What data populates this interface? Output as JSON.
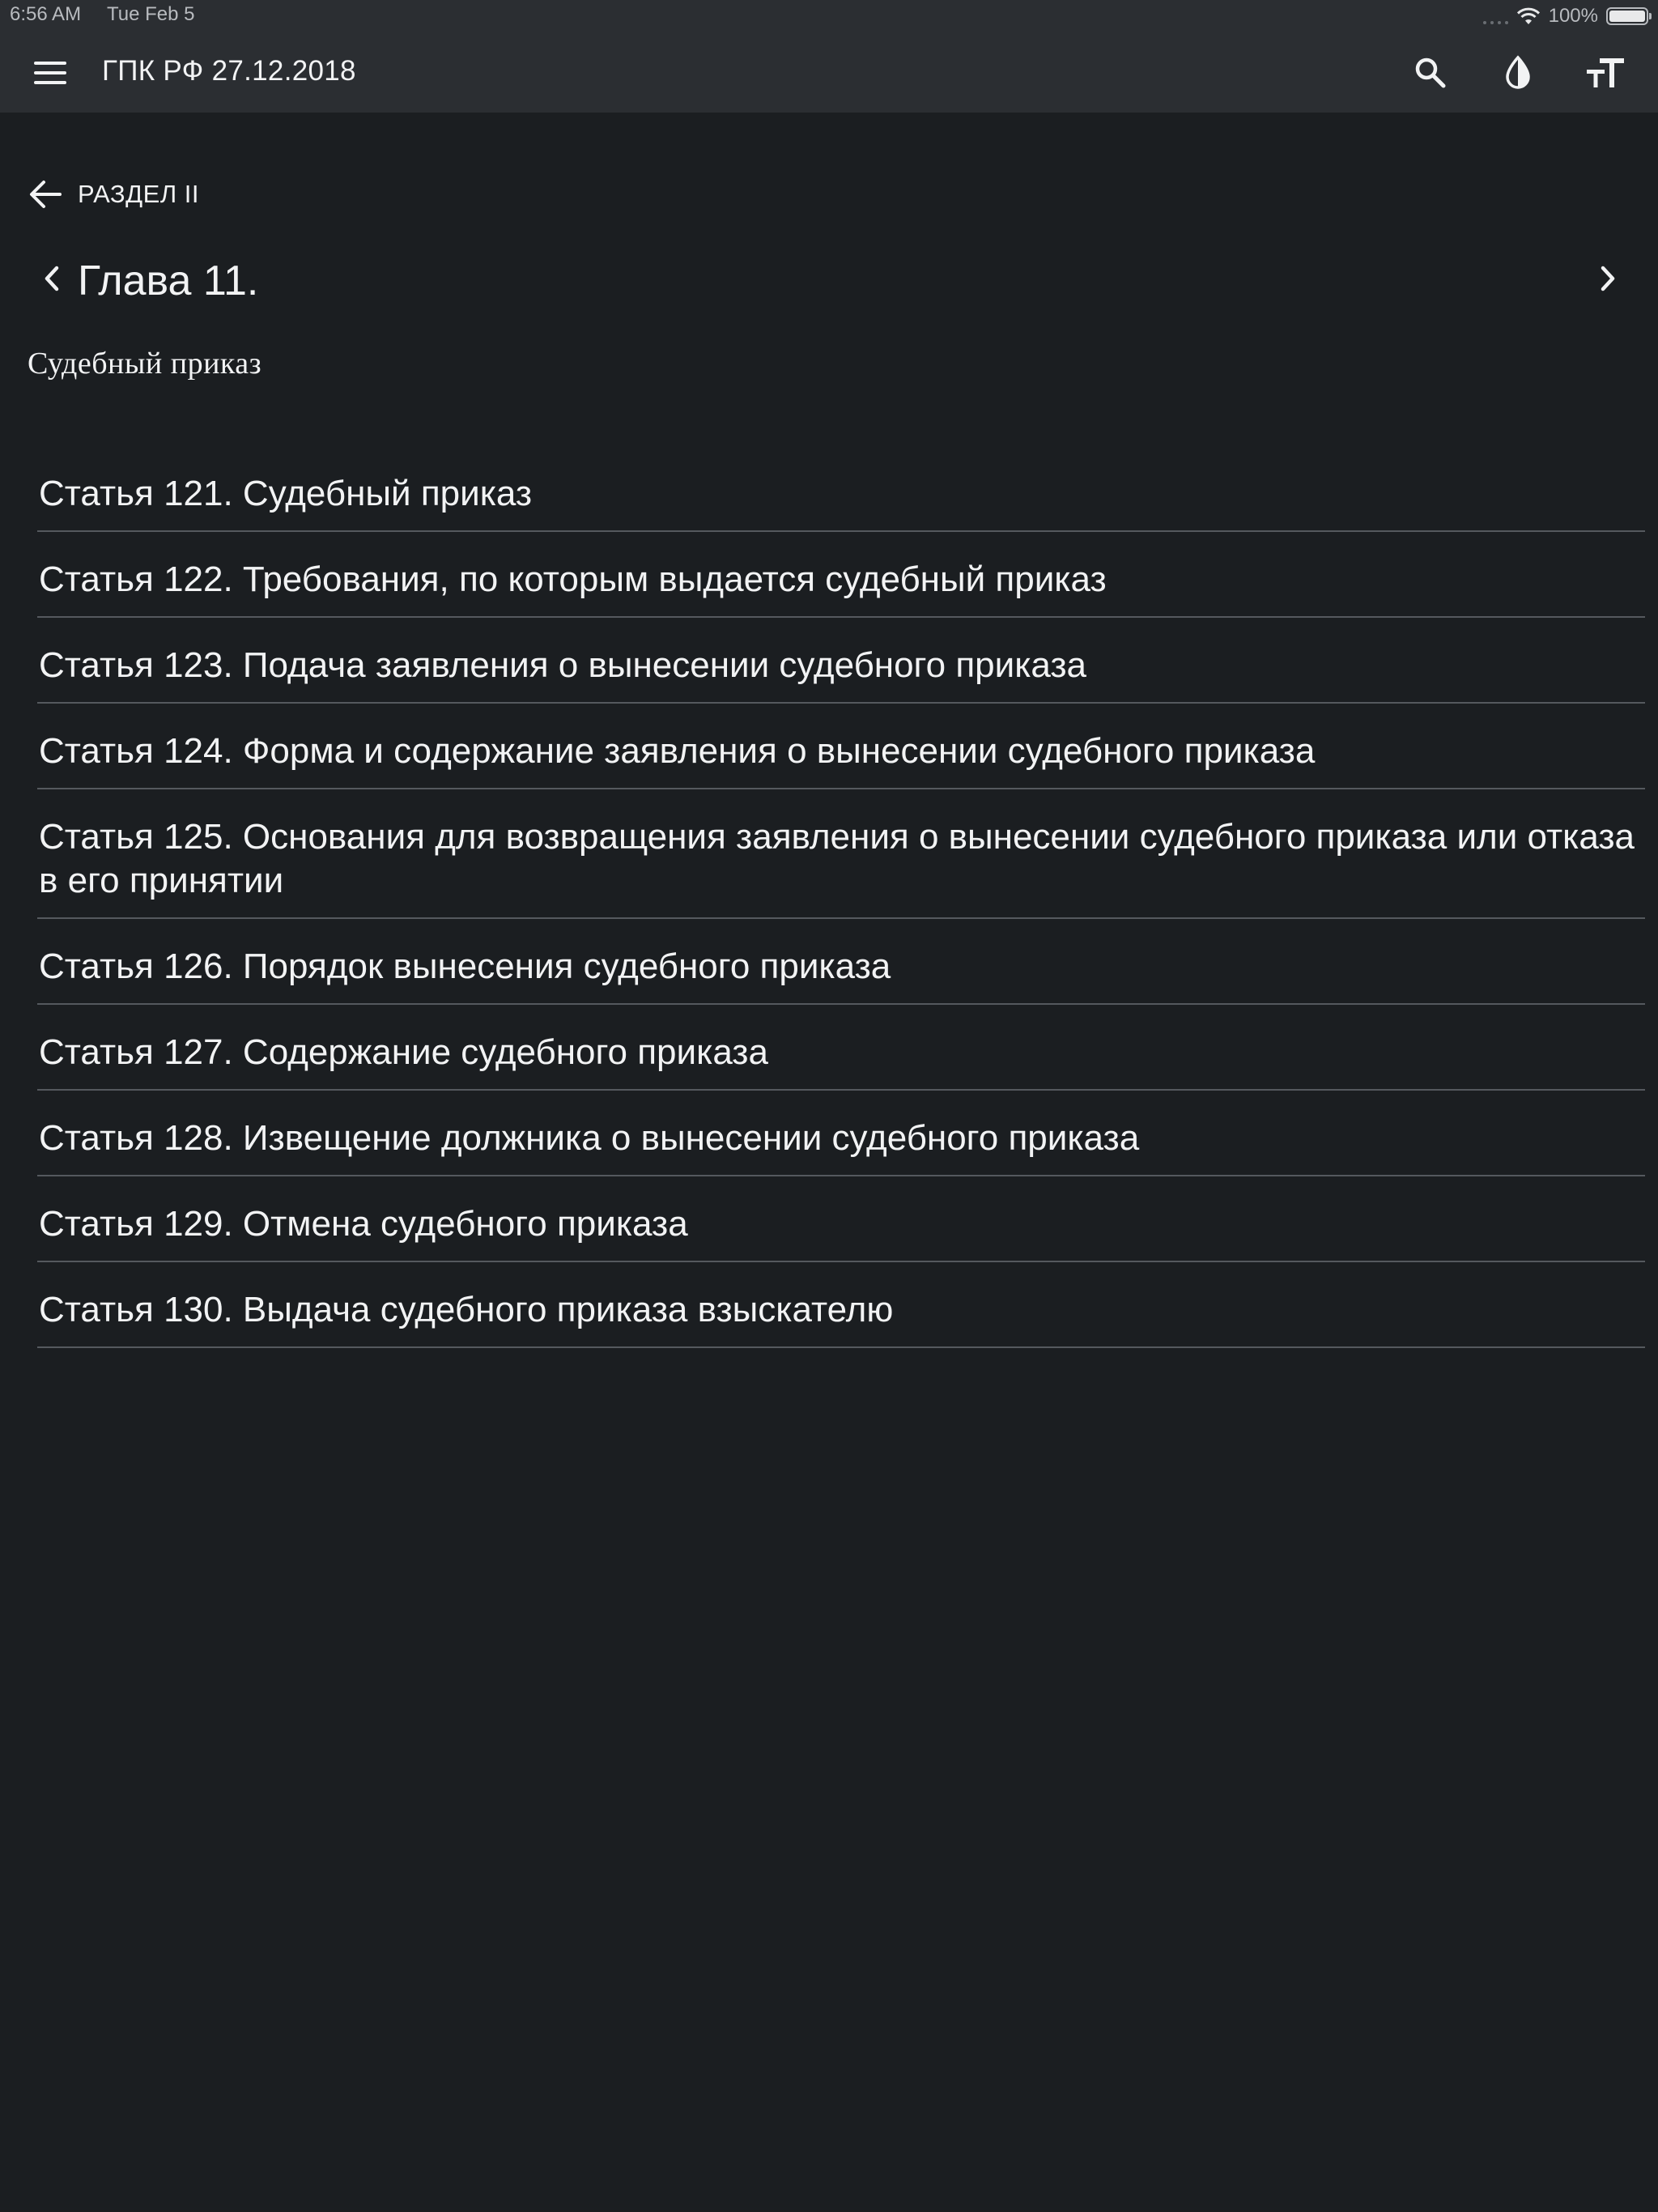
{
  "status_bar": {
    "time": "6:56 AM",
    "date": "Tue Feb 5",
    "battery": "100%"
  },
  "toolbar": {
    "title": "ГПК РФ 27.12.2018",
    "icons": [
      "menu-icon",
      "search-icon",
      "contrast-icon",
      "text-size-icon"
    ]
  },
  "navigation": {
    "back_label": "РАЗДЕЛ II",
    "chapter_title": "Глава 11.",
    "chapter_subtitle": "Судебный приказ"
  },
  "articles": [
    "Статья 121. Судебный приказ",
    "Статья 122. Требования, по которым выдается судебный приказ",
    "Статья 123. Подача заявления о вынесении судебного приказа",
    "Статья 124. Форма и содержание заявления о вынесении судебного приказа",
    "Статья 125. Основания для возвращения заявления о вынесении судебного приказа или отказа в его принятии",
    "Статья 126. Порядок вынесения судебного приказа",
    "Статья 127. Содержание судебного приказа",
    "Статья 128. Извещение должника о вынесении судебного приказа",
    "Статья 129. Отмена судебного приказа",
    "Статья 130. Выдача судебного приказа взыскателю"
  ],
  "colors": {
    "background": "#1b1e21",
    "toolbar": "#2b2e32",
    "text": "#f2f3f4",
    "divider": "#55595e"
  }
}
